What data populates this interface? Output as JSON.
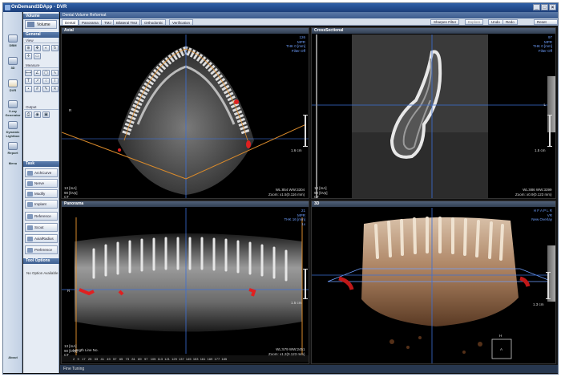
{
  "window": {
    "title": "OnDemand3DApp - DVR"
  },
  "titlebar_buttons": [
    "_",
    "□",
    "×"
  ],
  "leftbar": [
    {
      "label": "DBM",
      "icon": "database-icon"
    },
    {
      "label": "3D",
      "icon": "cube-icon"
    },
    {
      "label": "DVR",
      "icon": "tooth-icon"
    },
    {
      "label": "X-ray Generator",
      "icon": "xray-icon"
    },
    {
      "label": "Dynamic Lightbox",
      "icon": "lightbox-icon"
    },
    {
      "label": "Report",
      "icon": "report-icon"
    },
    {
      "label": "Menu",
      "icon": "menu-icon"
    },
    {
      "label": "About",
      "icon": "about-icon"
    }
  ],
  "panel": {
    "volume_header": "Volume",
    "volume_button": "Volume",
    "general_header": "General",
    "view_label": "View",
    "measure_label": "Measure",
    "output_label": "Output",
    "task_header": "Task",
    "tasks": [
      "ArchCurve",
      "Nerve",
      "Modify",
      "Implant",
      "Reference",
      "Scout",
      "AxialRadius",
      "Preference"
    ],
    "tool_options_header": "Tool Options",
    "tool_options_text": "No Option Available"
  },
  "main": {
    "title": "Dental Volume Reformat",
    "tabs": [
      "Dental",
      "Panorama",
      "TMJ",
      "Bilateral TMJ",
      "Orthodontic",
      "Verification"
    ],
    "active_tab": "Dental",
    "buttons": {
      "sharpen": "Sharpen Filter",
      "explore": "Explore",
      "undo": "Undo",
      "redo": "Redo",
      "reset": "Reset Zoom"
    },
    "bottom": "Fine Tuning"
  },
  "viewports": {
    "axial": {
      "title": "Axial",
      "tr": "126\nMPR\nTHK 0 [mm]\nFilter Off",
      "bl": "13 [mA]\n90 [kVp]\nCT",
      "br": "WL:854 WW:3304\nZoom: x1.5(0.116 mm)",
      "r_marker": "R",
      "scale": "1.6 cm"
    },
    "cross": {
      "title": "CrossSectional",
      "tr": "97\nMPR\nTHK 0 [mm]\nFilter Off",
      "bl": "13 [mA]\n90 [kVp]\nCT",
      "br": "WL:886 WW:3399\nZoom: x0.9(0.123 mm)",
      "l_marker": "L",
      "scale": "1.5 cm"
    },
    "panorama": {
      "title": "Panorama",
      "tr": "21\nMPR\nTHK 16 [mm]\n1x",
      "bl": "13 [mA]\n90 [kVp]\nCT",
      "br": "WL:579 WW:2451\nZoom: x1.2(0.123 mm)",
      "r_marker": "R",
      "scale": "1.5 cm",
      "length_label": "Length Line No.",
      "ruler": "2   9   17   25   33   41   49   57   65   73   81   89   97   105  113  121  129  137  145  153  161  169  177  185"
    },
    "dvr": {
      "title": "3D",
      "tr": "H F A P L R\nVR\nNew Overlay",
      "scale": "1.3 cm",
      "orient_top": "H",
      "orient_center": "A"
    }
  }
}
